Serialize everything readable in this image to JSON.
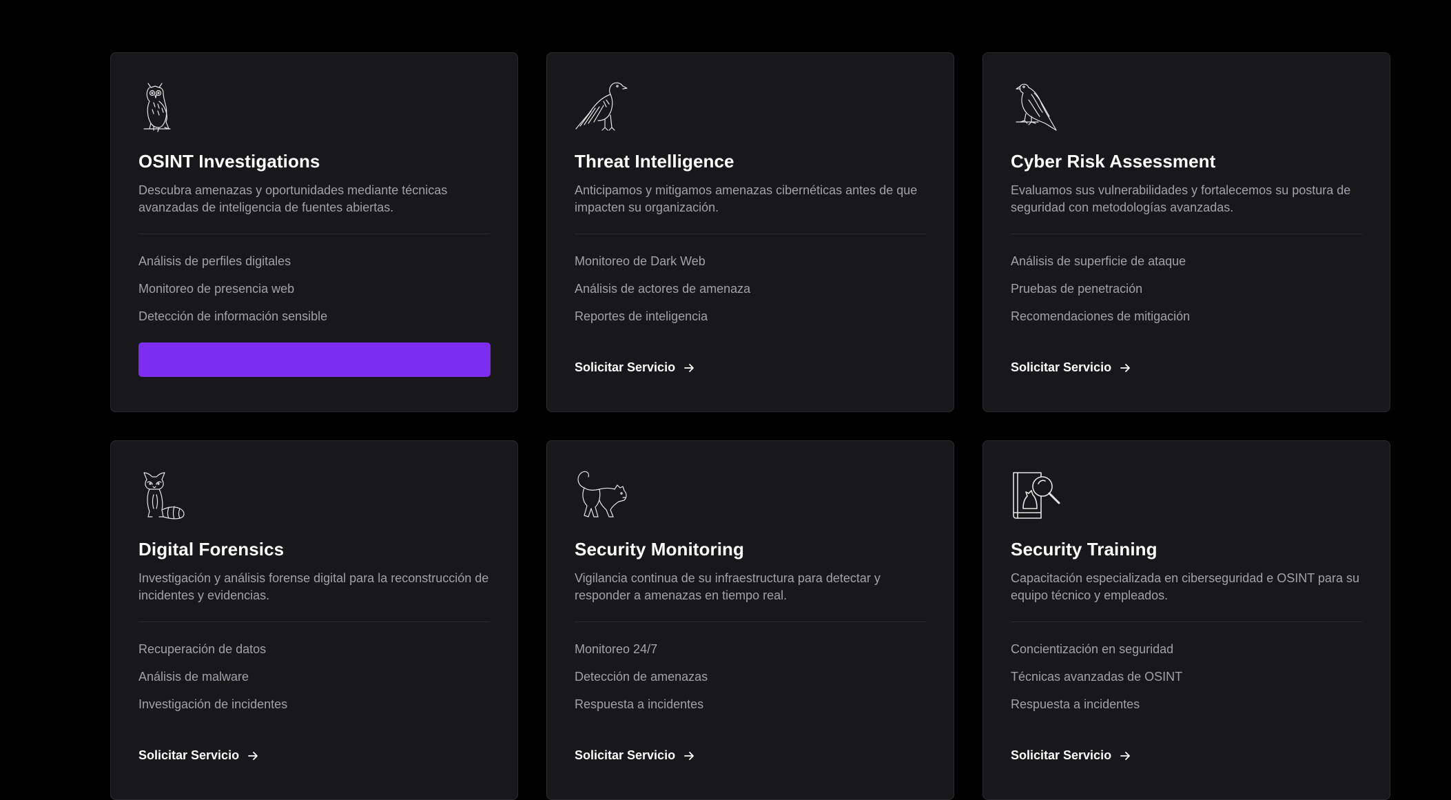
{
  "services": [
    {
      "icon": "owl-icon",
      "title": "OSINT Investigations",
      "description": "Descubra amenazas y oportunidades mediante técnicas avanzadas de inteligencia de fuentes abiertas.",
      "features": [
        "Análisis de perfiles digitales",
        "Monitoreo de presencia web",
        "Detección de información sensible"
      ],
      "cta_label": ""
    },
    {
      "icon": "raven-icon",
      "title": "Threat Intelligence",
      "description": "Anticipamos y mitigamos amenazas cibernéticas antes de que impacten su organización.",
      "features": [
        "Monitoreo de Dark Web",
        "Análisis de actores de amenaza",
        "Reportes de inteligencia"
      ],
      "cta_label": "Solicitar Servicio"
    },
    {
      "icon": "falcon-icon",
      "title": "Cyber Risk Assessment",
      "description": "Evaluamos sus vulnerabilidades y fortalecemos su postura de seguridad con metodologías avanzadas.",
      "features": [
        "Análisis de superficie de ataque",
        "Pruebas de penetración",
        "Recomendaciones de mitigación"
      ],
      "cta_label": "Solicitar Servicio"
    },
    {
      "icon": "raccoon-icon",
      "title": "Digital Forensics",
      "description": "Investigación y análisis forense digital para la reconstrucción de incidentes y evidencias.",
      "features": [
        "Recuperación de datos",
        "Análisis de malware",
        "Investigación de incidentes"
      ],
      "cta_label": "Solicitar Servicio"
    },
    {
      "icon": "panther-icon",
      "title": "Security Monitoring",
      "description": "Vigilancia continua de su infraestructura para detectar y responder a amenazas en tiempo real.",
      "features": [
        "Monitoreo 24/7",
        "Detección de amenazas",
        "Respuesta a incidentes"
      ],
      "cta_label": "Solicitar Servicio"
    },
    {
      "icon": "book-magnifier-icon",
      "title": "Security Training",
      "description": "Capacitación especializada en ciberseguridad e OSINT para su equipo técnico y empleados.",
      "features": [
        "Concientización en seguridad",
        "Técnicas avanzadas de OSINT",
        "Respuesta a incidentes"
      ],
      "cta_label": "Solicitar Servicio"
    }
  ],
  "colors": {
    "page_background": "#000000",
    "card_background": "#18181b",
    "card_border": "#2c2c30",
    "accent": "#7c2df0",
    "title": "#ffffff",
    "body_text": "#a1a1aa"
  }
}
